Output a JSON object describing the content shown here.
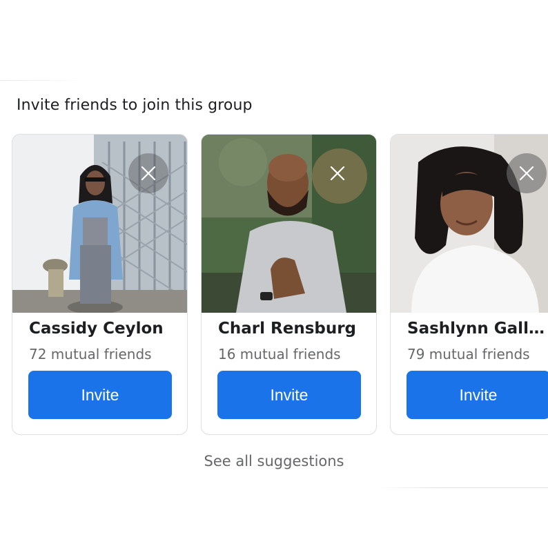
{
  "section": {
    "title": "Invite friends to join this group"
  },
  "suggestions": [
    {
      "name": "Cassidy Ceylon",
      "mutual": "72 mutual friends",
      "button": "Invite"
    },
    {
      "name": "Charl Rensburg",
      "mutual": "16 mutual friends",
      "button": "Invite"
    },
    {
      "name": "Sashlynn Gallag...",
      "mutual": "79 mutual friends",
      "button": "Invite"
    }
  ],
  "footer": {
    "see_all": "See all suggestions"
  },
  "colors": {
    "accent": "#1a73e8",
    "title_text": "#1c1e21",
    "secondary_text": "#65676b",
    "card_border": "#dcdfe3"
  },
  "icons": {
    "dismiss": "close-icon"
  }
}
